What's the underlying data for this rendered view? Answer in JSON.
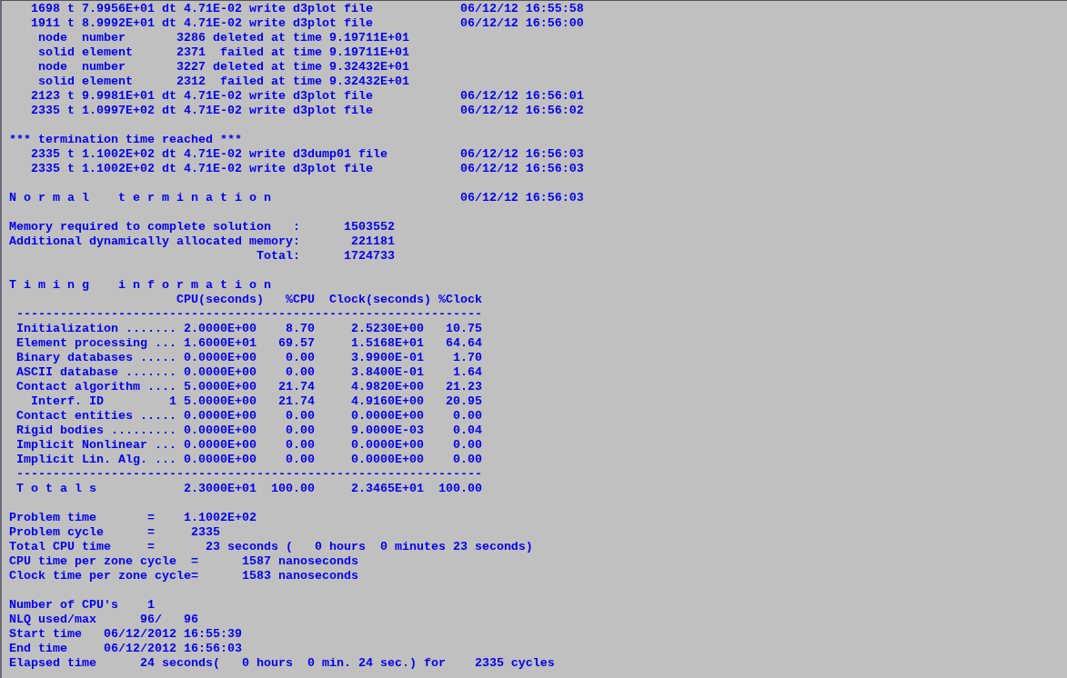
{
  "console": {
    "blocks": [
      [
        "   1698 t 7.9956E+01 dt 4.71E-02 write d3plot file            06/12/12 16:55:58",
        "   1911 t 8.9992E+01 dt 4.71E-02 write d3plot file            06/12/12 16:56:00",
        "    node  number       3286 deleted at time 9.19711E+01",
        "    solid element      2371  failed at time 9.19711E+01",
        "    node  number       3227 deleted at time 9.32432E+01",
        "    solid element      2312  failed at time 9.32432E+01",
        "   2123 t 9.9981E+01 dt 4.71E-02 write d3plot file            06/12/12 16:56:01",
        "   2335 t 1.0997E+02 dt 4.71E-02 write d3plot file            06/12/12 16:56:02"
      ],
      [
        "*** termination time reached ***",
        "   2335 t 1.1002E+02 dt 4.71E-02 write d3dump01 file          06/12/12 16:56:03",
        "   2335 t 1.1002E+02 dt 4.71E-02 write d3plot file            06/12/12 16:56:03"
      ],
      [
        "N o r m a l    t e r m i n a t i o n                          06/12/12 16:56:03"
      ],
      [
        "Memory required to complete solution   :      1503552",
        "Additional dynamically allocated memory:       221181",
        "                                  Total:      1724733"
      ],
      [
        "T i m i n g    i n f o r m a t i o n",
        "                       CPU(seconds)   %CPU  Clock(seconds) %Clock",
        " ----------------------------------------------------------------",
        " Initialization ....... 2.0000E+00    8.70     2.5230E+00   10.75",
        " Element processing ... 1.6000E+01   69.57     1.5168E+01   64.64",
        " Binary databases ..... 0.0000E+00    0.00     3.9900E-01    1.70",
        " ASCII database ....... 0.0000E+00    0.00     3.8400E-01    1.64",
        " Contact algorithm .... 5.0000E+00   21.74     4.9820E+00   21.23",
        "   Interf. ID         1 5.0000E+00   21.74     4.9160E+00   20.95",
        " Contact entities ..... 0.0000E+00    0.00     0.0000E+00    0.00",
        " Rigid bodies ......... 0.0000E+00    0.00     9.0000E-03    0.04",
        " Implicit Nonlinear ... 0.0000E+00    0.00     0.0000E+00    0.00",
        " Implicit Lin. Alg. ... 0.0000E+00    0.00     0.0000E+00    0.00",
        " ----------------------------------------------------------------",
        " T o t a l s            2.3000E+01  100.00     2.3465E+01  100.00"
      ],
      [
        "Problem time       =    1.1002E+02",
        "Problem cycle      =     2335",
        "Total CPU time     =       23 seconds (   0 hours  0 minutes 23 seconds)",
        "CPU time per zone cycle  =      1587 nanoseconds",
        "Clock time per zone cycle=      1583 nanoseconds"
      ],
      [
        "Number of CPU's    1",
        "NLQ used/max      96/   96",
        "Start time   06/12/2012 16:55:39",
        "End time     06/12/2012 16:56:03",
        "Elapsed time      24 seconds(   0 hours  0 min. 24 sec.) for    2335 cycles"
      ]
    ]
  }
}
